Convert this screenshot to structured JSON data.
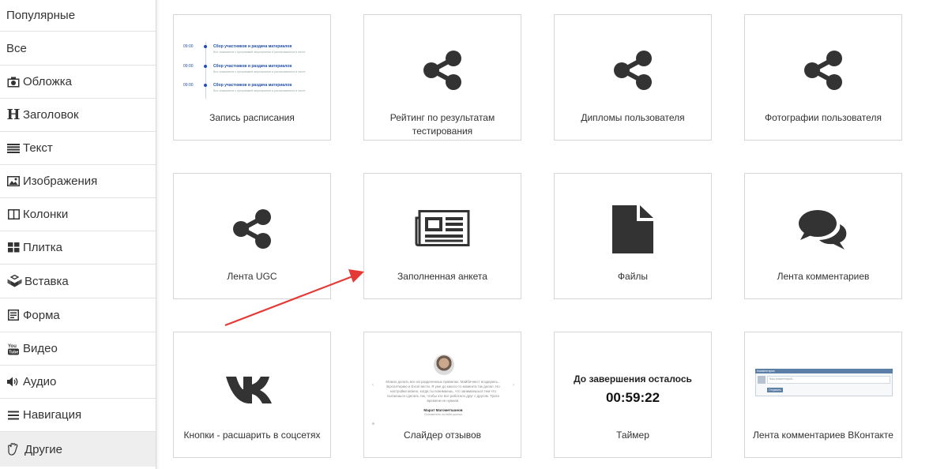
{
  "sidebar": {
    "items": [
      {
        "label": "Популярные",
        "icon": "none"
      },
      {
        "label": "Все",
        "icon": "none"
      },
      {
        "label": "Обложка",
        "icon": "camera-icon"
      },
      {
        "label": "Заголовок",
        "icon": "header-icon"
      },
      {
        "label": "Текст",
        "icon": "text-lines-icon"
      },
      {
        "label": "Изображения",
        "icon": "image-icon"
      },
      {
        "label": "Колонки",
        "icon": "columns-icon"
      },
      {
        "label": "Плитка",
        "icon": "tiles-icon"
      },
      {
        "label": "Вставка",
        "icon": "cubes-icon"
      },
      {
        "label": "Форма",
        "icon": "form-icon"
      },
      {
        "label": "Видео",
        "icon": "youtube-icon"
      },
      {
        "label": "Аудио",
        "icon": "volume-icon"
      },
      {
        "label": "Навигация",
        "icon": "menu-icon"
      },
      {
        "label": "Другие",
        "icon": "hand-icon",
        "active": true
      }
    ]
  },
  "cards": [
    {
      "label": "Запись расписания",
      "icon": "schedule-preview"
    },
    {
      "label": "Рейтинг по результатам тестирования",
      "icon": "share-icon"
    },
    {
      "label": "Дипломы пользователя",
      "icon": "share-icon"
    },
    {
      "label": "Фотографии пользователя",
      "icon": "share-icon"
    },
    {
      "label": "Лента UGC",
      "icon": "share-icon"
    },
    {
      "label": "Заполненная анкета",
      "icon": "newspaper-icon"
    },
    {
      "label": "Файлы",
      "icon": "file-icon"
    },
    {
      "label": "Лента комментариев",
      "icon": "comments-icon"
    },
    {
      "label": "Кнопки - расшарить в соцсетях",
      "icon": "vk-icon"
    },
    {
      "label": "Слайдер отзывов",
      "icon": "reviews-slider-preview"
    },
    {
      "label": "Таймер",
      "icon": "timer-preview"
    },
    {
      "label": "Лента комментариев ВКонтакте",
      "icon": "vk-comments-preview"
    }
  ],
  "schedule_preview": {
    "rows": [
      {
        "time": "09:00",
        "title": "Сбор участников и раздача материалов",
        "desc": "Все знакомятся с программой мероприятия и расписываются в листе"
      },
      {
        "time": "09:00",
        "title": "Сбор участников и раздача материалов",
        "desc": "Все знакомятся с программой мероприятия и расписываются в листе"
      },
      {
        "time": "09:00",
        "title": "Сбор участников и раздача материалов",
        "desc": "Все знакомятся с программой мероприятия и расписываются в листе"
      }
    ]
  },
  "reviews_preview": {
    "text": "Можно делать все на разделенных правилах. Майбичнест воздерись... Бухгалтерию и Excel вести. Я уже до какого-то момента так делал. Но настройки можно, когда ты понимаешь, что занимаешься тем что пытаешься сделать так, чтобы это все работало друг с другом. Трата времени не нужная.",
    "name": "Марат Магометшанов",
    "role": "Основатель онлайн-школы"
  },
  "timer_preview": {
    "heading": "До завершения осталось",
    "value": "00:59:22"
  },
  "vk_comments_preview": {
    "header": "Комментарии",
    "placeholder": "Ваш комментарий...",
    "button": "Отправить"
  },
  "colors": {
    "arrow": "#e53935",
    "icon_dark": "#333333",
    "schedule_blue": "#2350a7",
    "active_bg": "#eeeeee"
  }
}
